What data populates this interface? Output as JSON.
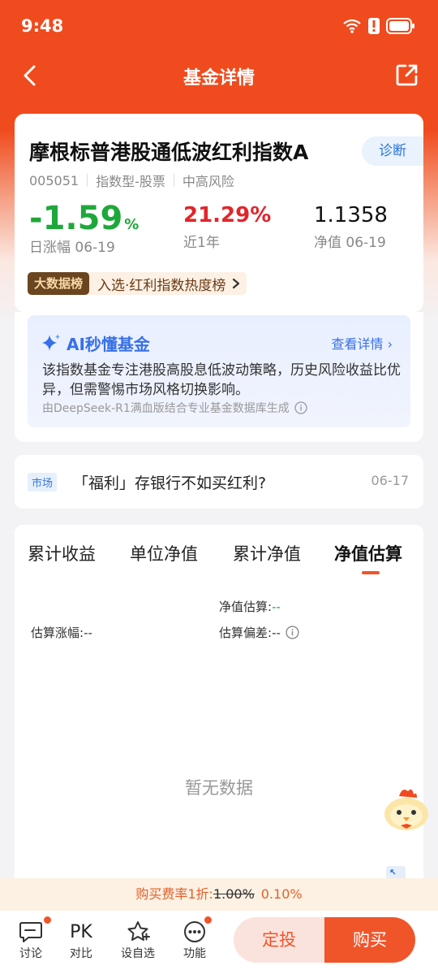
{
  "status": {
    "time": "9:48"
  },
  "nav": {
    "title": "基金详情"
  },
  "fund": {
    "name": "摩根标普港股通低波红利指数A",
    "diagnose_label": "诊断",
    "code": "005051",
    "type": "指数型-股票",
    "risk": "中高风险",
    "daily_change": "-1.59",
    "daily_change_unit": "%",
    "daily_label": "日涨幅 06-19",
    "year_return": "21.29%",
    "year_label": "近1年",
    "nav_value": "1.1358",
    "nav_label": "净值 06-19",
    "rank_badge": "大数据榜",
    "rank_text": "入选·红利指数热度榜"
  },
  "ai": {
    "title": "AI秒懂基金",
    "more": "查看详情",
    "body": "该指数基金专注港股高股息低波动策略，历史风险收益比优异，但需警惕市场风格切换影响。",
    "footer": "由DeepSeek-R1满血版结合专业基金数据库生成"
  },
  "news": {
    "tag": "市场",
    "text": "「福利」存银行不如买红利?",
    "date": "06-17"
  },
  "chart": {
    "tabs": [
      "累计收益",
      "单位净值",
      "累计净值",
      "净值估算"
    ],
    "active_tab": 3,
    "est_nav_label": "净值估算:",
    "est_nav_value": "--",
    "est_change_label": "估算涨幅:",
    "est_change_value": "--",
    "est_dev_label": "估算偏差:",
    "est_dev_value": "--",
    "empty": "暂无数据"
  },
  "fee": {
    "label": "购买费率1折:",
    "old": "1.00%",
    "new": "0.10%"
  },
  "bottom": {
    "discuss": "讨论",
    "compare_icon": "PK",
    "compare": "对比",
    "watchlist": "设自选",
    "functions": "功能",
    "sip": "定投",
    "buy": "购买"
  },
  "colors": {
    "brand": "#f0552a",
    "up": "#e0262b",
    "down": "#1fa83a",
    "link": "#3770e8"
  }
}
